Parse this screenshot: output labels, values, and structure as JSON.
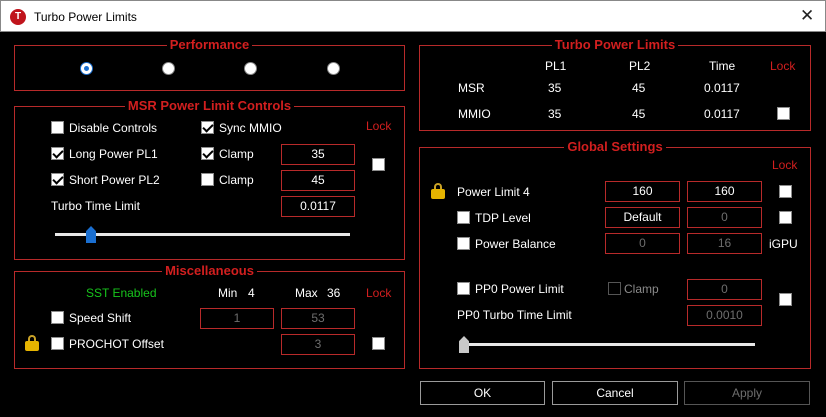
{
  "window": {
    "title": "Turbo Power Limits",
    "close": "✕",
    "icon_letter": "T"
  },
  "performance": {
    "title": "Performance",
    "selected_index": 0,
    "options": 4
  },
  "msr": {
    "title": "MSR Power Limit Controls",
    "lock": "Lock",
    "disable_controls": "Disable Controls",
    "sync_mmio": "Sync MMIO",
    "long_power": "Long Power PL1",
    "short_power": "Short Power PL2",
    "clamp1": "Clamp",
    "clamp2": "Clamp",
    "pl1_value": "35",
    "pl2_value": "45",
    "turbo_time_label": "Turbo Time Limit",
    "turbo_time_value": "0.0117",
    "slider_fraction": 0.12
  },
  "misc": {
    "title": "Miscellaneous",
    "sst_enabled": "SST Enabled",
    "min_label": "Min",
    "min_value": "4",
    "max_label": "Max",
    "max_value": "36",
    "lock": "Lock",
    "speed_shift": "Speed Shift",
    "speed_min": "1",
    "speed_max": "53",
    "prochot": "PROCHOT Offset",
    "prochot_value": "3"
  },
  "turbo": {
    "title": "Turbo Power Limits",
    "col_pl1": "PL1",
    "col_pl2": "PL2",
    "col_time": "Time",
    "lock": "Lock",
    "rows": [
      {
        "label": "MSR",
        "pl1": "35",
        "pl2": "45",
        "time": "0.0117"
      },
      {
        "label": "MMIO",
        "pl1": "35",
        "pl2": "45",
        "time": "0.0117"
      }
    ]
  },
  "global": {
    "title": "Global Settings",
    "lock": "Lock",
    "power_limit4": "Power Limit 4",
    "pl4_a": "160",
    "pl4_b": "160",
    "tdp_level": "TDP Level",
    "tdp_value": "Default",
    "tdp_b": "0",
    "power_balance": "Power Balance",
    "pb_a": "0",
    "pb_b": "16",
    "igpu": "iGPU",
    "pp0_limit": "PP0 Power Limit",
    "pp0_clamp": "Clamp",
    "pp0_value": "0",
    "pp0_turbo": "PP0 Turbo Time Limit",
    "pp0_turbo_value": "0.0010",
    "slider_fraction": 0.0
  },
  "buttons": {
    "ok": "OK",
    "cancel": "Cancel",
    "apply": "Apply"
  }
}
